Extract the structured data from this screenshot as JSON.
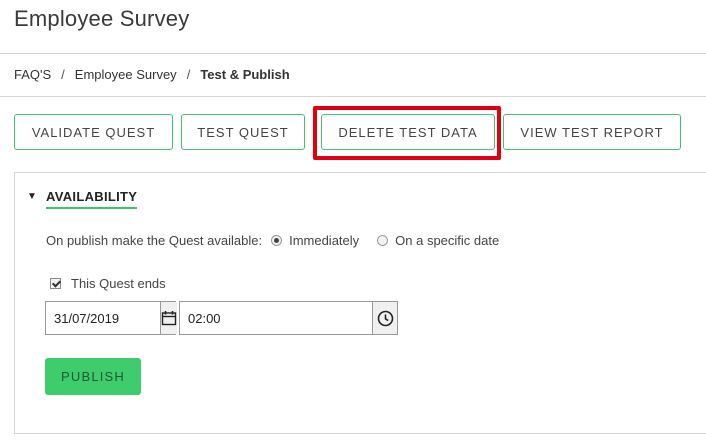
{
  "header": {
    "title": "Employee Survey"
  },
  "breadcrumb": {
    "items": [
      "FAQ'S",
      "Employee Survey",
      "Test & Publish"
    ],
    "separator": "/"
  },
  "toolbar": {
    "validate": "VALIDATE QUEST",
    "test": "TEST QUEST",
    "delete": "DELETE TEST DATA",
    "report": "VIEW TEST REPORT"
  },
  "availability": {
    "title": "AVAILABILITY",
    "toggle": "▼",
    "publish_label": "On publish make the Quest available:",
    "options": [
      "Immediately",
      "On a specific date"
    ],
    "selected_option": "Immediately",
    "ends_label": "This Quest ends",
    "ends_checked": true,
    "end_date": "31/07/2019",
    "end_time": "02:00"
  },
  "publish": {
    "label": "PUBLISH"
  },
  "colors": {
    "accent": "#3ec46d",
    "highlight": "#e0000f",
    "publish_bg": "#3fcc6d"
  }
}
